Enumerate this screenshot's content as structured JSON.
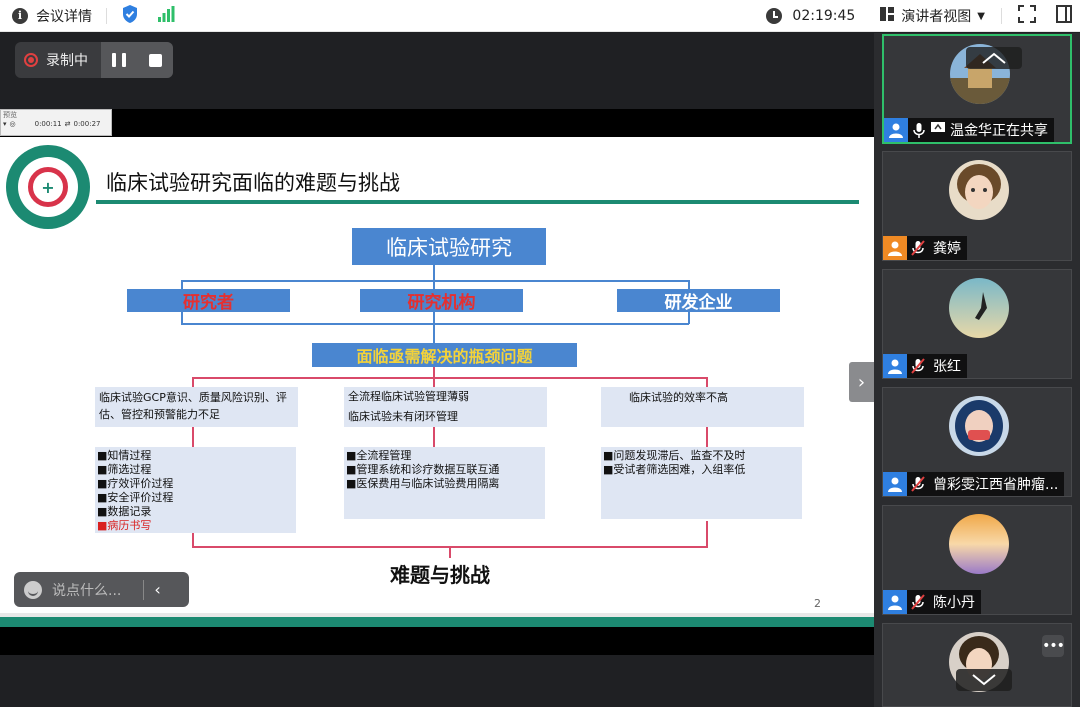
{
  "topbar": {
    "meeting_details": "会议详情",
    "timer": "02:19:45",
    "view_mode": "演讲者视图"
  },
  "recording": {
    "status": "录制中"
  },
  "mini_player": {
    "title": "预览",
    "current_time": "0:00:11",
    "total_time": "0:00:27"
  },
  "slide": {
    "title": "临床试验研究面临的难题与挑战",
    "top_box": "临床试验研究",
    "stakeholders": [
      "研究者",
      "研究机构",
      "研发企业"
    ],
    "bottleneck": "面临亟需解决的瓶颈问题",
    "issues": [
      "临床试验GCP意识、质量风险识别、评估、管控和预警能力不足",
      "全流程临床试验管理薄弱\n临床试验未有闭环管理",
      "临床试验的效率不高"
    ],
    "details_1": [
      "■知情过程",
      "■筛选过程",
      "■疗效评价过程",
      "■安全评价过程",
      "■数据记录"
    ],
    "details_1_red": "■病历书写",
    "details_2": [
      "■全流程管理",
      "■管理系统和诊疗数据互联互通",
      "■医保费用与临床试验费用隔离"
    ],
    "details_3": [
      "■问题发现滞后、监查不及时",
      "■受试者筛选困难，入组率低"
    ],
    "conclusion": "难题与挑战",
    "page_number": "2"
  },
  "chat": {
    "placeholder": "说点什么..."
  },
  "participants": [
    {
      "name": "温金华正在共享",
      "active": true
    },
    {
      "name": "龚婷"
    },
    {
      "name": "张红"
    },
    {
      "name": "曾彩雯江西省肿瘤..."
    },
    {
      "name": "陈小丹"
    },
    {
      "name": ""
    }
  ],
  "colors": {
    "accent_green": "#1c8a72",
    "slide_blue": "#4a86d0",
    "active_border": "#2fbf6a",
    "record_red": "#e04040"
  }
}
